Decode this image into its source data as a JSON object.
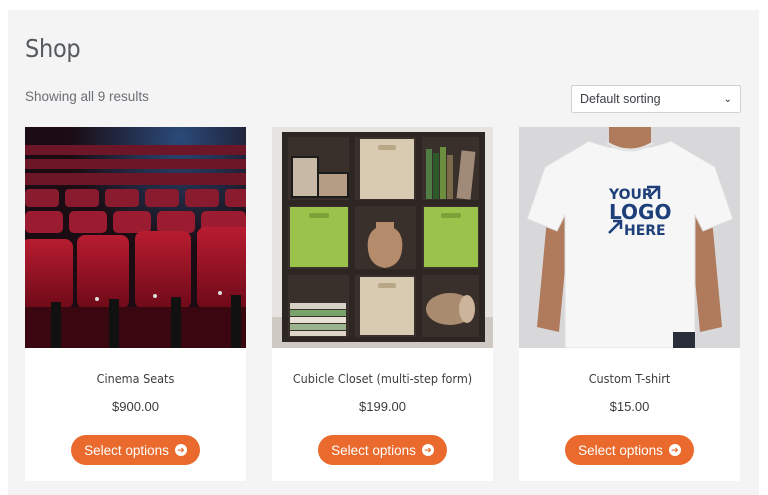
{
  "shop": {
    "title": "Shop",
    "result_count": "Showing all 9 results",
    "sorting": {
      "selected": "Default sorting"
    }
  },
  "products": [
    {
      "name": "Cinema Seats",
      "price": "$900.00",
      "button": "Select options"
    },
    {
      "name": "Cubicle Closet (multi-step form)",
      "price": "$199.00",
      "button": "Select options"
    },
    {
      "name": "Custom T-shirt",
      "price": "$15.00",
      "button": "Select options"
    }
  ],
  "tshirt_print": {
    "line1": "YOUR",
    "line2": "LOGO",
    "line3": "HERE"
  },
  "colors": {
    "accent": "#e96a2c",
    "page_bg": "#f4f4f5",
    "card_bg": "#ffffff",
    "text": "#3a3d40"
  }
}
